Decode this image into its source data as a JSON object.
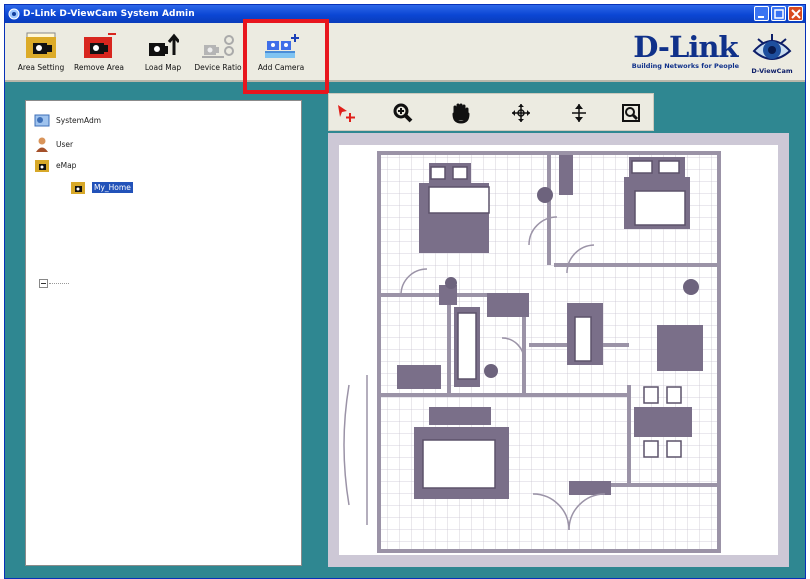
{
  "window": {
    "title": "D-Link D-ViewCam System Admin"
  },
  "toolbar": {
    "buttons": [
      {
        "label": "Area Setting",
        "icon": "area-setting-icon"
      },
      {
        "label": "Remove Area",
        "icon": "remove-area-icon"
      },
      {
        "label": "Load Map",
        "icon": "load-map-icon"
      },
      {
        "label": "Device Ratio",
        "icon": "device-ratio-icon"
      },
      {
        "label": "Add Camera",
        "icon": "add-camera-icon"
      }
    ],
    "highlighted": "Add Camera"
  },
  "brand": {
    "name": "D-Link",
    "tagline": "Building Networks for People",
    "product": "D-ViewCam"
  },
  "tree": {
    "items": [
      {
        "label": "SystemAdm",
        "icon": "system-admin-icon"
      },
      {
        "label": "User",
        "icon": "user-icon"
      },
      {
        "label": "eMap",
        "icon": "emap-icon"
      },
      {
        "label": "My_Home",
        "icon": "map-folder-icon",
        "selected": true
      }
    ]
  },
  "map_toolbar": {
    "tools": [
      "select-move-icon",
      "zoom-in-icon",
      "pan-hand-icon",
      "move-all-icon",
      "move-vertical-icon",
      "zoom-fit-icon"
    ]
  },
  "colors": {
    "accent": "#e8161e",
    "title_bar": "#0b46d4",
    "background": "#2f8791",
    "wall": "#9b93a7",
    "furniture": "#7a6f89"
  }
}
